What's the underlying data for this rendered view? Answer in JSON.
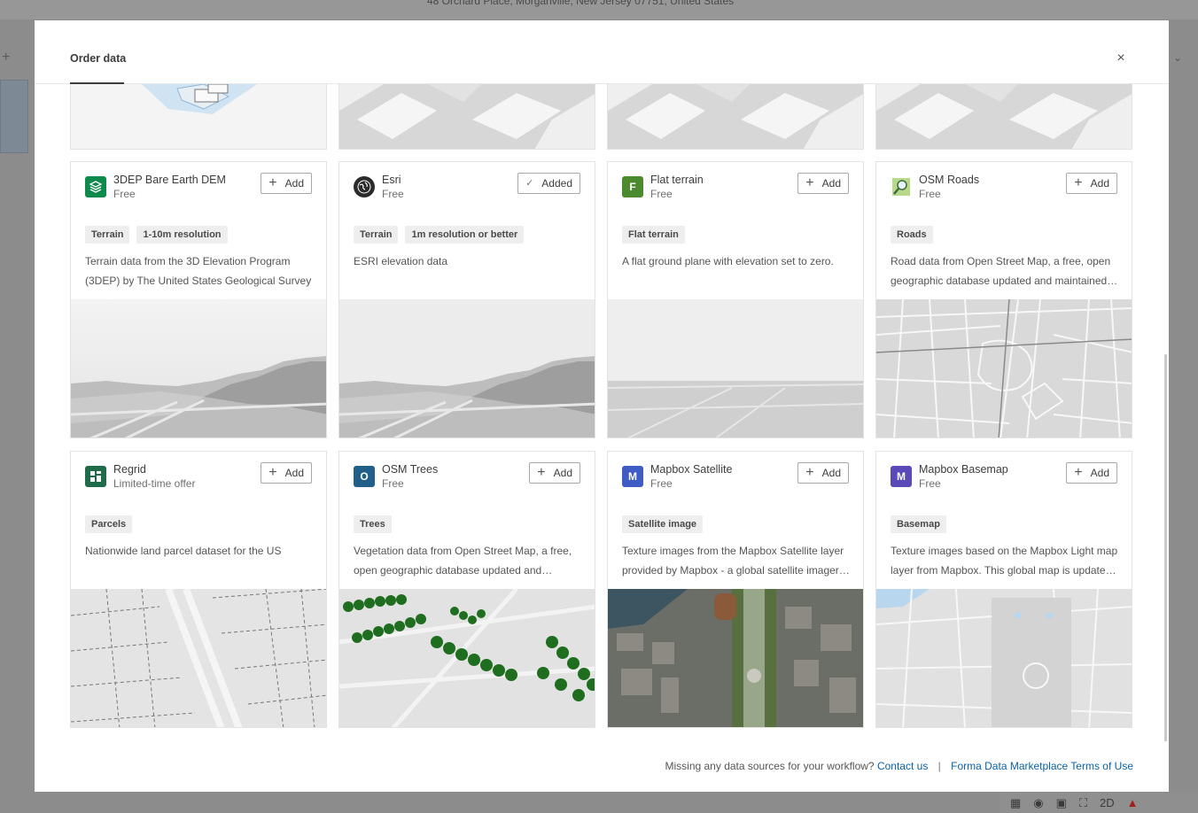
{
  "background": {
    "address": "48 Orchard Place, Morganville, New Jersey 07751, United States",
    "view_toggle": "2D"
  },
  "modal": {
    "title": "Order data",
    "close_label": "×"
  },
  "cards": [
    {
      "name": "3DEP Bare Earth DEM",
      "price": "Free",
      "button": "Add",
      "state": "add",
      "tags": [
        "Terrain",
        "1-10m resolution"
      ],
      "description": "Terrain data from the 3D Elevation Program (3DEP) by The United States Geological Survey",
      "logo": "grid-icon",
      "logo_color": "#0e8a4c",
      "image": "terrain"
    },
    {
      "name": "Esri",
      "price": "Free",
      "button": "Added",
      "state": "added",
      "tags": [
        "Terrain",
        "1m resolution or better"
      ],
      "description": "ESRI elevation data",
      "logo": "globe-icon",
      "logo_color": "#2b2b2b",
      "image": "terrain"
    },
    {
      "name": "Flat terrain",
      "price": "Free",
      "button": "Add",
      "state": "add",
      "tags": [
        "Flat terrain"
      ],
      "description": "A flat ground plane with elevation set to zero.",
      "logo": "F",
      "logo_color": "#4b8a2e",
      "image": "flat"
    },
    {
      "name": "OSM Roads",
      "price": "Free",
      "button": "Add",
      "state": "add",
      "tags": [
        "Roads"
      ],
      "description": "Road data from Open Street Map, a free, open geographic database updated and maintained by volunteers",
      "logo": "magnifier-icon",
      "logo_color": "#9bc24a",
      "image": "roads"
    },
    {
      "name": "Regrid",
      "price": "Limited-time offer",
      "button": "Add",
      "state": "add",
      "tags": [
        "Parcels"
      ],
      "description": "Nationwide land parcel dataset for the US",
      "logo": "parcel-icon",
      "logo_color": "#1f6b4a",
      "image": "parcels"
    },
    {
      "name": "OSM Trees",
      "price": "Free",
      "button": "Add",
      "state": "add",
      "tags": [
        "Trees"
      ],
      "description": "Vegetation data from Open Street Map, a free, open geographic database updated and maintained by volunteers",
      "logo": "O",
      "logo_color": "#1f5f8a",
      "image": "trees"
    },
    {
      "name": "Mapbox Satellite",
      "price": "Free",
      "button": "Add",
      "state": "add",
      "tags": [
        "Satellite image"
      ],
      "description": "Texture images from the Mapbox Satellite layer provided by Mapbox - a global satellite imagery layer",
      "logo": "M",
      "logo_color": "#3f5cc4",
      "image": "satellite"
    },
    {
      "name": "Mapbox Basemap",
      "price": "Free",
      "button": "Add",
      "state": "add",
      "tags": [
        "Basemap"
      ],
      "description": "Texture images based on the Mapbox Light map layer from Mapbox. This global map is updated regularly",
      "logo": "M",
      "logo_color": "#5a4ab8",
      "image": "basemap"
    }
  ],
  "footer": {
    "question": "Missing any data sources for your workflow?",
    "contact": "Contact us",
    "separator": "|",
    "terms": "Forma Data Marketplace Terms of Use"
  }
}
